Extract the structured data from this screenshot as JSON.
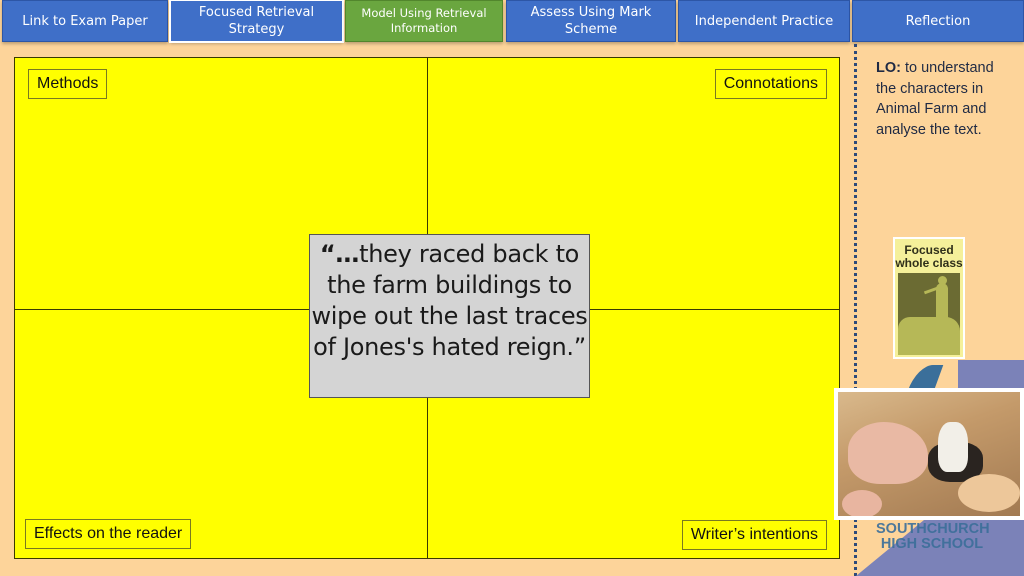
{
  "nav": {
    "items": [
      {
        "label": "Link to Exam Paper",
        "active": false
      },
      {
        "label": "Focused Retrieval Strategy",
        "active": false
      },
      {
        "label": "Model Using Retrieval Information",
        "active": true
      },
      {
        "label": "Assess Using Mark Scheme",
        "active": false
      },
      {
        "label": "Independent Practice",
        "active": false
      },
      {
        "label": "Reflection",
        "active": false
      }
    ],
    "colors": {
      "default": "#3f6fc8",
      "active": "#6aa63f"
    }
  },
  "grid": {
    "labels": {
      "top_left": "Methods",
      "top_right": "Connotations",
      "bottom_left": "Effects on the reader",
      "bottom_right": "Writer’s intentions"
    },
    "quote": {
      "open": "“…",
      "text": "they raced back to the farm buildings to wipe out the last traces of Jones's hated reign.",
      "close": "”"
    },
    "background_color": "#ffff00"
  },
  "sidebar": {
    "lo_label": "LO:",
    "lo_text": " to understand the characters in Animal Farm and analyse the text.",
    "focused_card_title": "Focused whole class",
    "school_name_line1": "SOUTHCHURCH",
    "school_name_line2": "HIGH SCHOOL"
  }
}
